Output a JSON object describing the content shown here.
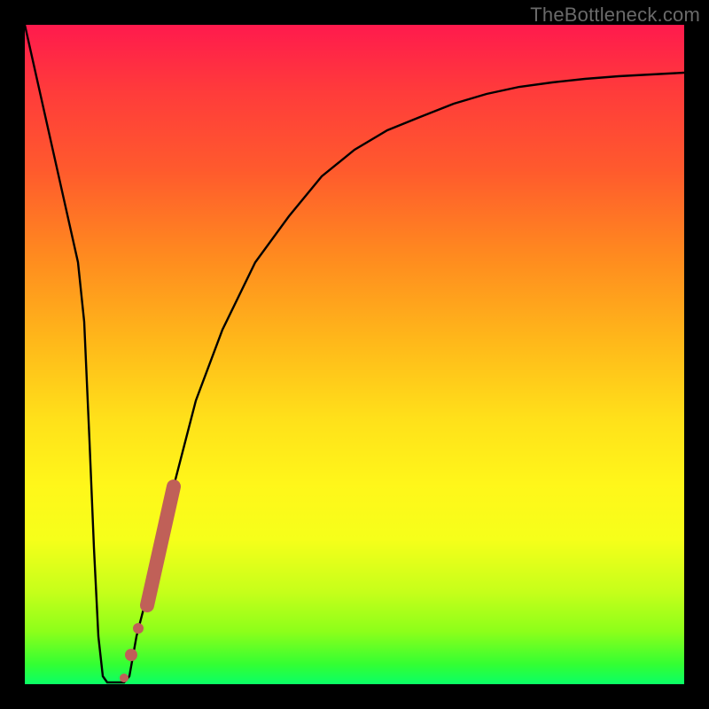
{
  "watermark": "TheBottleneck.com",
  "colors": {
    "curve": "#000000",
    "markers": "#c06058",
    "background_black": "#000000"
  },
  "chart_data": {
    "type": "line",
    "title": "",
    "xlabel": "",
    "ylabel": "",
    "xlim": [
      0,
      100
    ],
    "ylim": [
      0,
      100
    ],
    "grid": false,
    "legend": false,
    "series": [
      {
        "name": "bottleneck-curve-left-drop",
        "x": [
          0,
          2,
          4,
          6,
          8,
          9,
          10
        ],
        "values": [
          100,
          82,
          64,
          46,
          28,
          10,
          0
        ]
      },
      {
        "name": "bottleneck-curve-flat-bottom",
        "x": [
          10,
          11,
          12,
          13,
          14,
          15
        ],
        "values": [
          0,
          0,
          0,
          0,
          0,
          0
        ]
      },
      {
        "name": "bottleneck-curve-right-rise",
        "x": [
          15,
          17,
          19,
          22,
          26,
          30,
          35,
          40,
          45,
          50,
          55,
          60,
          65,
          70,
          75,
          80,
          85,
          90,
          95,
          100
        ],
        "values": [
          0,
          7,
          15,
          28,
          43,
          54,
          64,
          71,
          77,
          81,
          84,
          86,
          88,
          89.5,
          90.5,
          91.2,
          91.8,
          92.2,
          92.5,
          92.8
        ]
      }
    ],
    "markers": [
      {
        "name": "thick-segment",
        "x_range": [
          18.5,
          22.5
        ],
        "y_range": [
          12,
          30
        ],
        "style": "thick-line",
        "width": 16
      },
      {
        "name": "dot-1",
        "x": 17.2,
        "y": 8.5,
        "style": "circle",
        "r": 6
      },
      {
        "name": "dot-2",
        "x": 16.2,
        "y": 4.5,
        "style": "circle",
        "r": 7
      },
      {
        "name": "dot-3",
        "x": 15.0,
        "y": 1.0,
        "style": "circle",
        "r": 5
      }
    ]
  }
}
